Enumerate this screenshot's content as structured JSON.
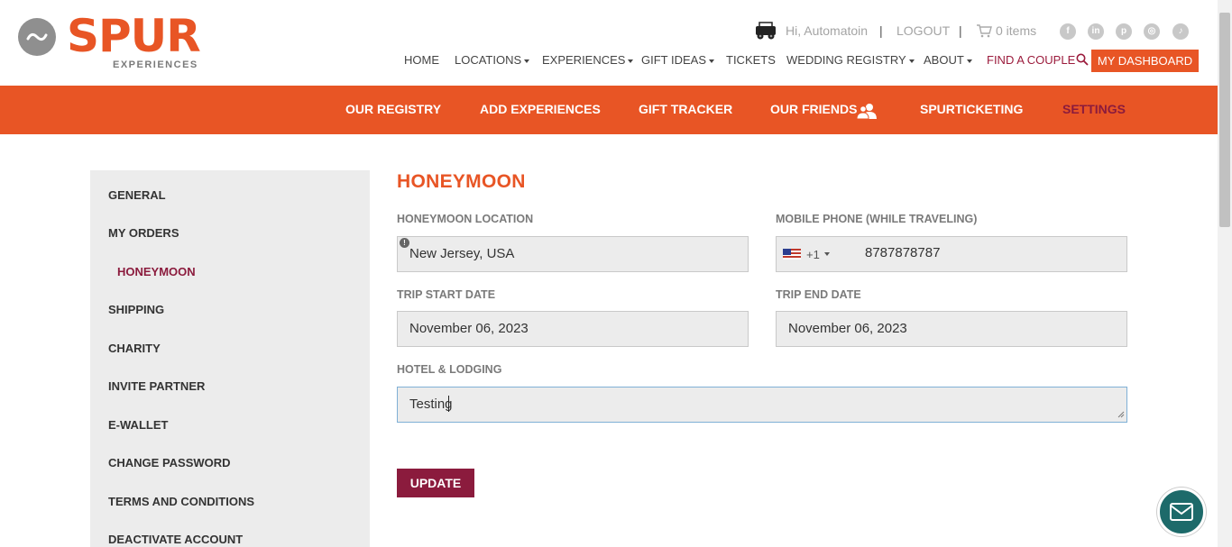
{
  "brand": {
    "name": "SPUR",
    "tagline": "EXPERIENCES",
    "accent": "#e85525",
    "secondary": "#8b1b3d"
  },
  "utility": {
    "greeting": "Hi, Automatoin",
    "logout": "LOGOUT",
    "cart": "0 items",
    "separator": "|",
    "social": [
      "facebook-icon",
      "linkedin-icon",
      "pinterest-icon",
      "instagram-icon",
      "tiktok-icon"
    ]
  },
  "nav": {
    "home": "HOME",
    "locations": "LOCATIONS",
    "experiences": "EXPERIENCES",
    "gift_ideas": "GIFT IDEAS",
    "tickets": "TICKETS",
    "wedding_registry": "WEDDING REGISTRY",
    "about": "ABOUT",
    "find_couple": "FIND A COUPLE",
    "dashboard": "MY DASHBOARD"
  },
  "subnav": {
    "registry": "OUR REGISTRY",
    "add_experiences": "ADD EXPERIENCES",
    "gift_tracker": "GIFT TRACKER",
    "friends": "OUR FRIENDS",
    "ticketing": "SPURTICKETING",
    "settings": "SETTINGS"
  },
  "sidebar": {
    "general": "GENERAL",
    "my_orders": "MY ORDERS",
    "honeymoon": "HONEYMOON",
    "shipping": "SHIPPING",
    "charity": "CHARITY",
    "invite_partner": "INVITE PARTNER",
    "ewallet": "E-WALLET",
    "change_password": "CHANGE PASSWORD",
    "terms": "TERMS AND CONDITIONS",
    "deactivate": "DEACTIVATE ACCOUNT"
  },
  "form": {
    "title": "HONEYMOON",
    "location_label": "HONEYMOON LOCATION",
    "location_value": "New Jersey, USA",
    "phone_label": "MOBILE PHONE (WHILE TRAVELING)",
    "phone_code": "+1",
    "phone_value": "8787878787",
    "start_label": "TRIP START DATE",
    "start_value": "November 06, 2023",
    "end_label": "TRIP END DATE",
    "end_value": "November 06, 2023",
    "hotel_label": "HOTEL & LODGING",
    "hotel_value": "Testing",
    "update": "UPDATE"
  }
}
